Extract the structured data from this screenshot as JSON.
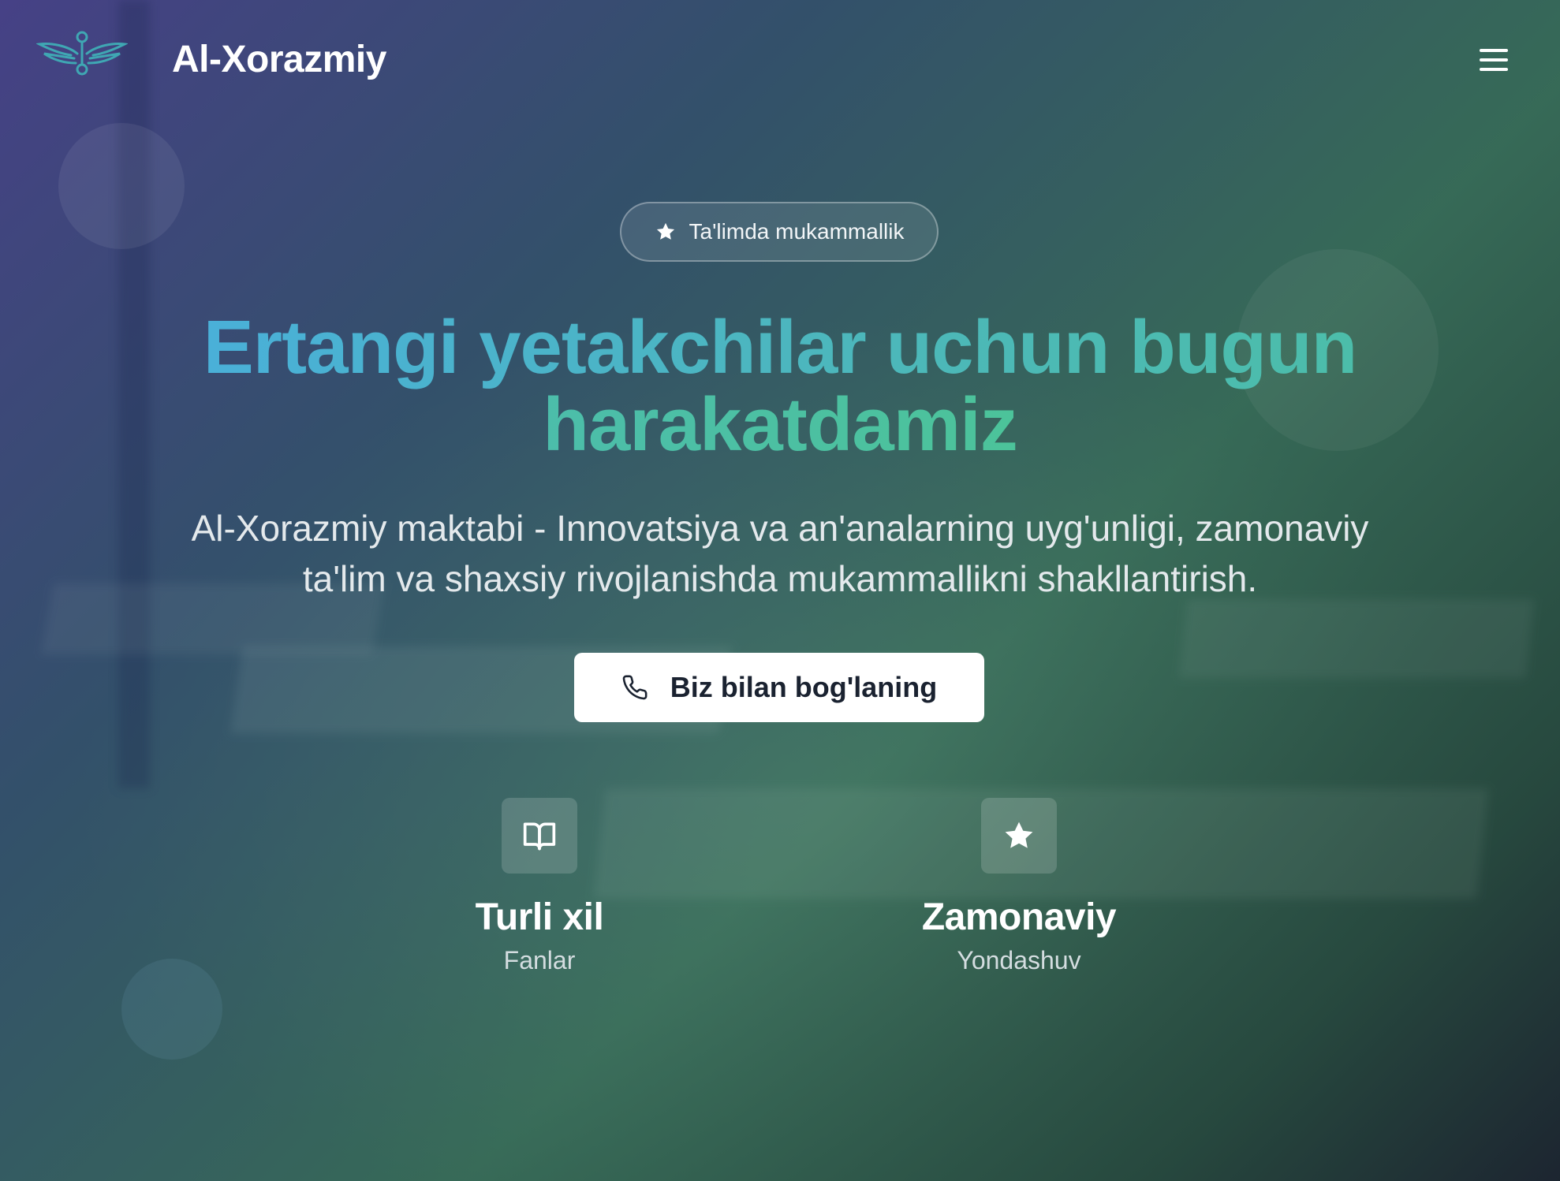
{
  "header": {
    "brand_name": "Al-Xorazmiy",
    "logo_icon": "winged-emblem-icon",
    "menu_icon": "hamburger-menu-icon"
  },
  "hero": {
    "badge": {
      "icon": "star-icon",
      "text": "Ta'limda mukammallik"
    },
    "headline": "Ertangi yetakchilar uchun bugun harakatdamiz",
    "description": "Al-Xorazmiy maktabi - Innovatsiya va an'analarning uyg'unligi, zamonaviy ta'lim va shaxsiy rivojlanishda mukammallikni shakllantirish.",
    "cta": {
      "icon": "phone-icon",
      "label": "Biz bilan bog'laning"
    },
    "features": [
      {
        "icon": "book-open-icon",
        "title": "Turli xil",
        "subtitle": "Fanlar"
      },
      {
        "icon": "star-icon",
        "title": "Zamonaviy",
        "subtitle": "Yondashuv"
      }
    ]
  },
  "colors": {
    "headline_gradient_start": "#4ab0d8",
    "headline_gradient_end": "#4cc39a",
    "logo_color": "#3fa7b3",
    "cta_background": "#ffffff",
    "cta_text": "#1a2230"
  }
}
